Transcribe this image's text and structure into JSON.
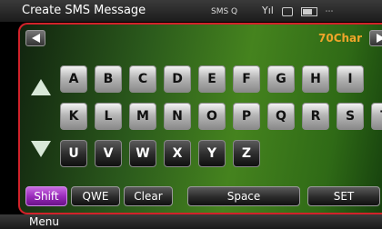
{
  "header": {
    "title": "Create SMS Message",
    "status_text": "SMS Q",
    "signal": "Yıl"
  },
  "editor": {
    "char_counter": "70Char"
  },
  "keyboard": {
    "rows": [
      [
        "A",
        "B",
        "C",
        "D",
        "E",
        "F",
        "G",
        "H",
        "I"
      ],
      [
        "K",
        "L",
        "M",
        "N",
        "O",
        "P",
        "Q",
        "R",
        "S",
        "T"
      ],
      [
        "U",
        "V",
        "W",
        "X",
        "Y",
        "Z"
      ]
    ]
  },
  "functions": {
    "shift": "Shift",
    "qwe": "QWE",
    "clear": "Clear",
    "space": "Space",
    "set": "SET"
  },
  "footer": {
    "menu": "Menu"
  },
  "icons": [
    "left-arrow-icon",
    "right-arrow-icon",
    "scroll-up-icon",
    "scroll-down-icon",
    "back-icon",
    "camera-icon",
    "battery-icon"
  ],
  "colors": {
    "accent_border": "#d2222a",
    "counter": "#f0a52a",
    "shift_key": "#9a2cbc"
  }
}
